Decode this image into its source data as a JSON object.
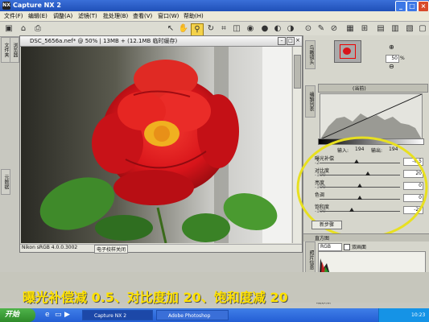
{
  "window": {
    "title": "Capture NX 2",
    "min": "_",
    "max": "□",
    "close": "×"
  },
  "menu": [
    "文件(F)",
    "编辑(E)",
    "调整(A)",
    "滤镜(T)",
    "批处理(B)",
    "查看(V)",
    "窗口(W)",
    "帮助(H)"
  ],
  "left_tabs": [
    "文件夹",
    "浏览器",
    "元数据"
  ],
  "image_window": {
    "title": "DSC_5656a.nef* @ 50% | 13MB + (12.1MB 临时缓存)",
    "status_profile": "Nikon sRGB 4.0.0.3002",
    "status_proof": "电子校样关闭"
  },
  "right_panel": {
    "bird_label": "鸟瞰镜头",
    "zoom_value": "50",
    "zoom_unit": "%",
    "edit_list_label": "编辑列表",
    "curve_channel": "(当前)",
    "input_label": "输入:",
    "input_value": "194",
    "output_label": "输出:",
    "output_value": "194",
    "sliders": [
      {
        "label": "曝光补偿",
        "min": "-2",
        "value": "-0.5",
        "pos": 0.45
      },
      {
        "label": "对比度",
        "min": "-100",
        "value": "20",
        "pos": 0.6
      },
      {
        "label": "亮度",
        "min": "-100",
        "value": "0",
        "pos": 0.5
      },
      {
        "label": "色调",
        "min": "",
        "value": "0",
        "pos": 0.5
      },
      {
        "label": "饱和度",
        "min": "-100",
        "value": "-20",
        "pos": 0.4
      }
    ],
    "new_step": "新步骤",
    "histogram_title": "直方图",
    "histogram_side": "照片信息",
    "histogram_channel": "RGB",
    "dual_view": "双画面",
    "on_label": "开始",
    "watermark": "观察点"
  },
  "caption": "曝光补偿减 0.5、对比度加 20、饱和度减 20",
  "taskbar": {
    "start": "开始",
    "tasks": [
      "Capture NX 2",
      "Adobe Photoshop"
    ],
    "clock": "10:23"
  },
  "colors": {
    "caption": "#ffe200",
    "rose": "#d8141a",
    "ellipse": "#e8e020"
  }
}
